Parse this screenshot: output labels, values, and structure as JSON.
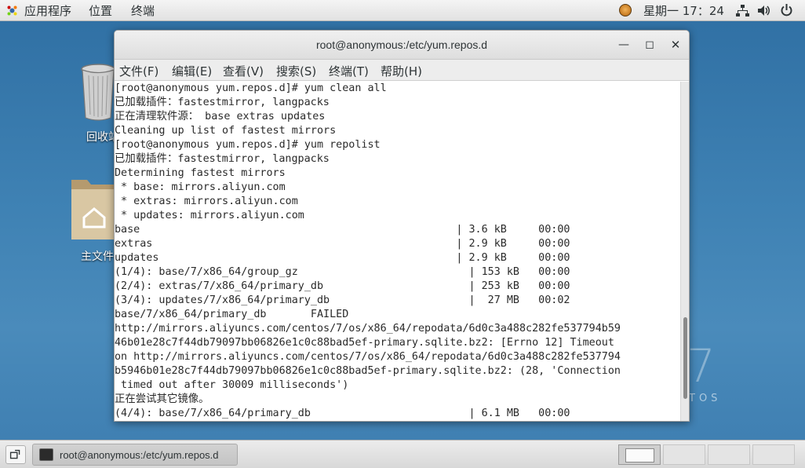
{
  "topbar": {
    "apps_menu": "应用程序",
    "places_menu": "位置",
    "terminal_menu": "终端",
    "clock": "星期一 17：24"
  },
  "desktop": {
    "trash_label": "回收站",
    "home_label": "主文件夹",
    "centos_watermark": "7",
    "centos_text": "TOS"
  },
  "window": {
    "title": "root@anonymous:/etc/yum.repos.d",
    "minimize": "—",
    "maximize": "◻",
    "close": "✕",
    "menu": {
      "file": "文件(F)",
      "edit": "编辑(E)",
      "view": "查看(V)",
      "search": "搜索(S)",
      "terminal": "终端(T)",
      "help": "帮助(H)"
    }
  },
  "terminal": {
    "lines": [
      "[root@anonymous yum.repos.d]# yum clean all",
      "已加载插件：fastestmirror, langpacks",
      "正在清理软件源： base extras updates",
      "Cleaning up list of fastest mirrors",
      "[root@anonymous yum.repos.d]# yum repolist",
      "已加载插件：fastestmirror, langpacks",
      "Determining fastest mirrors",
      " * base: mirrors.aliyun.com",
      " * extras: mirrors.aliyun.com",
      " * updates: mirrors.aliyun.com",
      "base                                                  | 3.6 kB     00:00",
      "extras                                                | 2.9 kB     00:00",
      "updates                                               | 2.9 kB     00:00",
      "(1/4): base/7/x86_64/group_gz                           | 153 kB   00:00",
      "(2/4): extras/7/x86_64/primary_db                       | 253 kB   00:00",
      "(3/4): updates/7/x86_64/primary_db                      |  27 MB   00:02",
      "base/7/x86_64/primary_db       FAILED",
      "http://mirrors.aliyuncs.com/centos/7/os/x86_64/repodata/6d0c3a488c282fe537794b59",
      "46b01e28c7f44db79097bb06826e1c0c88bad5ef-primary.sqlite.bz2: [Errno 12] Timeout",
      "on http://mirrors.aliyuncs.com/centos/7/os/x86_64/repodata/6d0c3a488c282fe537794",
      "b5946b01e28c7f44db79097bb06826e1c0c88bad5ef-primary.sqlite.bz2: (28, 'Connection",
      " timed out after 30009 milliseconds')",
      "正在尝试其它镜像。",
      "(4/4): base/7/x86_64/primary_db                         | 6.1 MB   00:00"
    ]
  },
  "taskbar": {
    "task_label": "root@anonymous:/etc/yum.repos.d"
  }
}
